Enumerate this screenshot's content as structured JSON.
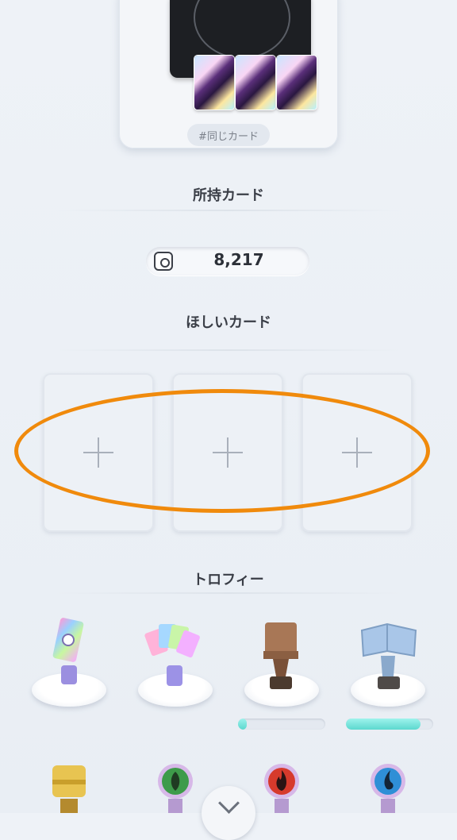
{
  "deck": {
    "tag": "#同じカード"
  },
  "owned": {
    "title": "所持カード",
    "count": "8,217"
  },
  "wishlist": {
    "title": "ほしいカード",
    "slots": [
      "+",
      "+",
      "+"
    ]
  },
  "trophies": {
    "title": "トロフィー",
    "items": [
      {
        "name": "pack-trophy-icon"
      },
      {
        "name": "card-fan-trophy-icon"
      },
      {
        "name": "bronze-box-trophy-icon",
        "progress": 0.1
      },
      {
        "name": "silver-book-trophy-icon",
        "progress": 0.85
      }
    ],
    "row2": [
      "gold-box-trophy-icon",
      "grass-type-trophy-icon",
      "fire-type-trophy-icon",
      "water-type-trophy-icon"
    ]
  },
  "colors": {
    "highlight": "#f08a0c",
    "progress": "#5cd8cf"
  }
}
